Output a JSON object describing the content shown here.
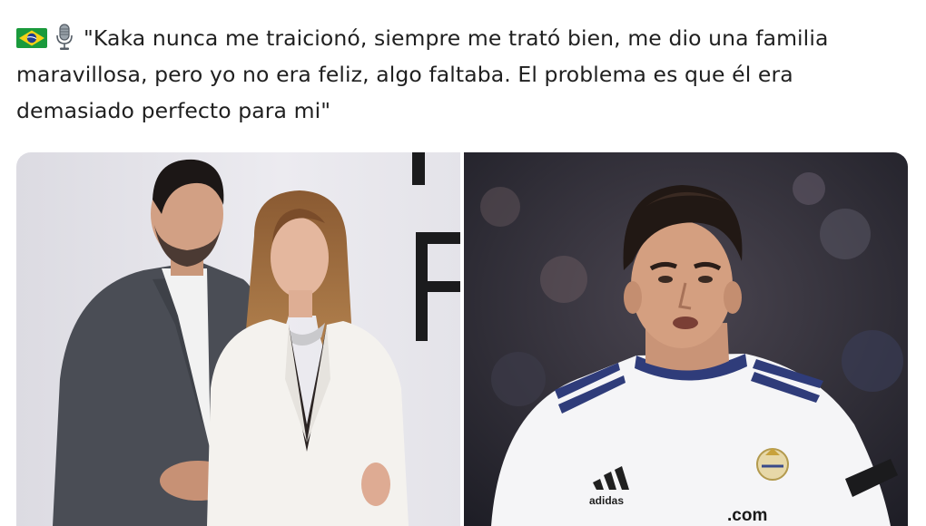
{
  "post": {
    "emoji": {
      "flag": "brazil-flag-icon",
      "mic": "microphone-icon"
    },
    "quote": "\"Kaka nunca me traicionó, siempre me trató bien, me dio una familia maravillosa, pero yo no era feliz, algo faltaba. El problema es que él era demasiado perfecto para mi\""
  },
  "media": {
    "left_photo": {
      "backdrop_letters": [
        "F"
      ],
      "colors": {
        "backdrop": "#e8e6ec",
        "suit": "#4a4d55",
        "blazer": "#f4f2ee"
      }
    },
    "right_photo": {
      "jersey_text": ".com",
      "jersey_brand": "adidas",
      "colors": {
        "background": "#2a2b35",
        "jersey": "#f5f5f7",
        "stripes": "#2f3c7a"
      }
    }
  }
}
